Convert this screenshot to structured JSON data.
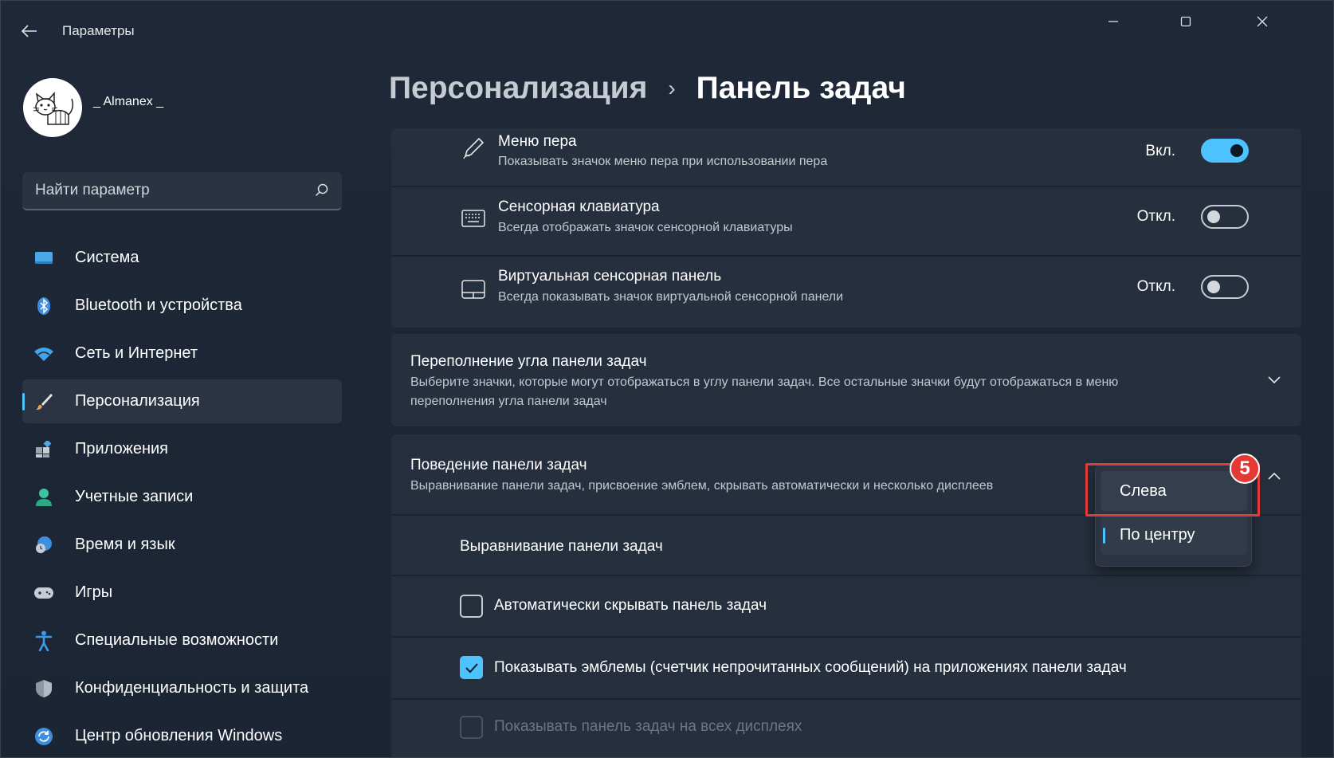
{
  "app": {
    "title": "Параметры"
  },
  "profile": {
    "username": "_ Almanex _"
  },
  "search": {
    "placeholder": "Найти параметр"
  },
  "sidebar": {
    "items": [
      {
        "label": "Система",
        "icon": "monitor-icon"
      },
      {
        "label": "Bluetooth и устройства",
        "icon": "bluetooth-icon"
      },
      {
        "label": "Сеть и Интернет",
        "icon": "wifi-icon"
      },
      {
        "label": "Персонализация",
        "icon": "brush-icon",
        "active": true
      },
      {
        "label": "Приложения",
        "icon": "apps-icon"
      },
      {
        "label": "Учетные записи",
        "icon": "person-icon"
      },
      {
        "label": "Время и язык",
        "icon": "globe-clock-icon"
      },
      {
        "label": "Игры",
        "icon": "gamepad-icon"
      },
      {
        "label": "Специальные возможности",
        "icon": "accessibility-icon"
      },
      {
        "label": "Конфиденциальность и защита",
        "icon": "shield-icon"
      },
      {
        "label": "Центр обновления Windows",
        "icon": "update-icon"
      }
    ]
  },
  "breadcrumb": {
    "parent": "Персонализация",
    "separator": "›",
    "current": "Панель задач"
  },
  "corner_icons": [
    {
      "title": "Меню пера",
      "desc": "Показывать значок меню пера при использовании пера",
      "state": "Вкл.",
      "on": true,
      "icon": "pen-icon"
    },
    {
      "title": "Сенсорная клавиатура",
      "desc": "Всегда отображать значок сенсорной клавиатуры",
      "state": "Откл.",
      "on": false,
      "icon": "keyboard-icon"
    },
    {
      "title": "Виртуальная сенсорная панель",
      "desc": "Всегда показывать значок виртуальной сенсорной панели",
      "state": "Откл.",
      "on": false,
      "icon": "touchpad-icon"
    }
  ],
  "overflow": {
    "title": "Переполнение угла панели задач",
    "desc_line1": "Выберите значки, которые могут отображаться в углу панели задач. Все остальные значки будут отображаться в меню",
    "desc_line2": "переполнения угла панели задач"
  },
  "behavior": {
    "title": "Поведение панели задач",
    "desc": "Выравнивание панели задач, присвоение эмблем, скрывать автоматически и несколько дисплеев",
    "alignment_label": "Выравнивание панели задач",
    "alignment_options": [
      "Слева",
      "По центру"
    ],
    "alignment_selected": "По центру",
    "autohide_label": "Автоматически скрывать панель задач",
    "autohide_checked": false,
    "badges_label": "Показывать эмблемы (счетчик непрочитанных сообщений) на приложениях панели задач",
    "badges_checked": true,
    "all_displays_label": "Показывать панель задач на всех дисплеях",
    "all_displays_enabled": false
  },
  "annotation": {
    "number": "5"
  },
  "colors": {
    "accent": "#4cc2ff",
    "annotation": "#e53935"
  }
}
